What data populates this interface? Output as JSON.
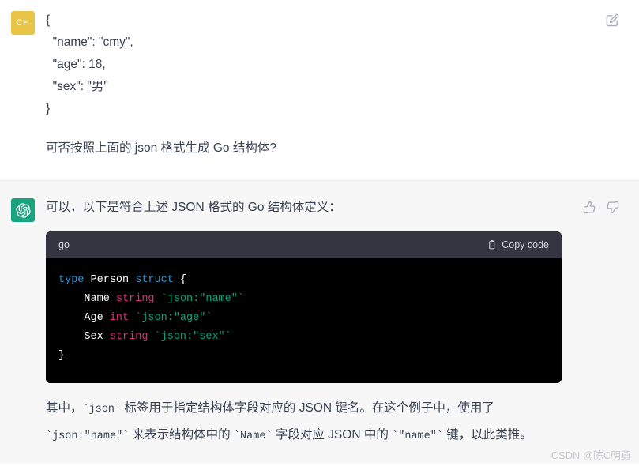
{
  "conversation": {
    "user_message": {
      "avatar_initials": "CH",
      "avatar_color": "#e8c547",
      "json_snippet": "{\n  \"name\": \"cmy\",\n  \"age\": 18,\n  \"sex\": \"男\"\n}",
      "question": "可否按照上面的 json 格式生成 Go 结构体?",
      "edit_icon": "edit-pencil-square-icon"
    },
    "assistant_message": {
      "avatar_color": "#19a37f",
      "avatar_icon": "openai-logo-icon",
      "intro": "可以，以下是符合上述 JSON 格式的 Go 结构体定义：",
      "feedback": {
        "thumbs_up_icon": "thumbs-up-icon",
        "thumbs_down_icon": "thumbs-down-icon"
      },
      "code_block": {
        "language": "go",
        "copy_label": "Copy code",
        "copy_icon": "clipboard-icon",
        "lines": [
          [
            {
              "t": "type ",
              "c": "kw"
            },
            {
              "t": "Person ",
              "c": "name"
            },
            {
              "t": "struct ",
              "c": "kw"
            },
            {
              "t": "{",
              "c": "plain"
            }
          ],
          [
            {
              "t": "    Name ",
              "c": "name"
            },
            {
              "t": "string ",
              "c": "type"
            },
            {
              "t": "`json:\"name\"`",
              "c": "tag"
            }
          ],
          [
            {
              "t": "    Age ",
              "c": "name"
            },
            {
              "t": "int ",
              "c": "type"
            },
            {
              "t": "`json:\"age\"`",
              "c": "tag"
            }
          ],
          [
            {
              "t": "    Sex ",
              "c": "name"
            },
            {
              "t": "string ",
              "c": "type"
            },
            {
              "t": "`json:\"sex\"`",
              "c": "tag"
            }
          ],
          [
            {
              "t": "}",
              "c": "plain"
            }
          ]
        ]
      },
      "explanation_line1_a": "其中，",
      "explanation_line1_code": "`json`",
      "explanation_line1_b": " 标签用于指定结构体字段对应的 JSON 键名。在这个例子中，使用了",
      "explanation_line2_code1": "`json:\"name\"`",
      "explanation_line2_a": " 来表示结构体中的 ",
      "explanation_line2_code2": "`Name`",
      "explanation_line2_b": " 字段对应 JSON 中的 ",
      "explanation_line2_code3": "`\"name\"`",
      "explanation_line2_c": " 键，以此类推。"
    }
  },
  "watermark": "CSDN @陈C明勇"
}
